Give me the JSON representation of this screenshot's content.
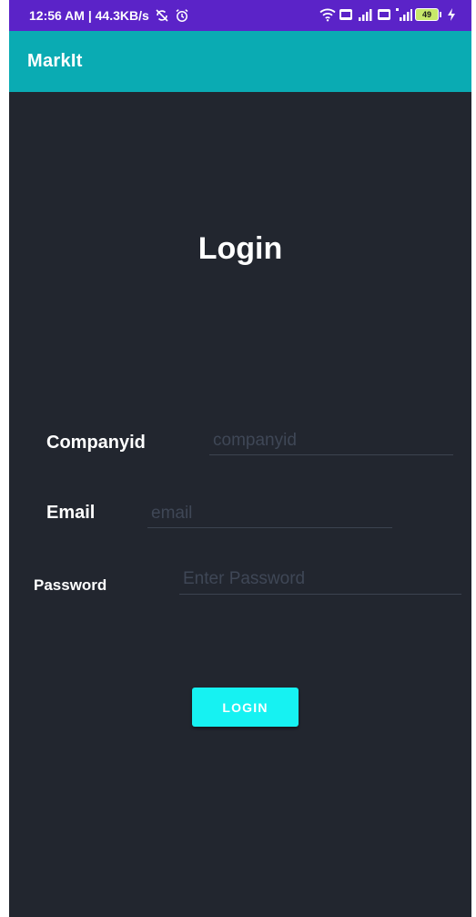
{
  "status_bar": {
    "time_speed": "12:56 AM | 44.3KB/s",
    "battery": "49",
    "colors": {
      "background": "#5b23c8"
    },
    "icons": [
      "no-sync-icon",
      "alarm-icon",
      "wifi-icon",
      "volte-icon",
      "signal-icon",
      "volte-icon-2",
      "4g-signal-icon",
      "battery-icon",
      "charging-icon"
    ]
  },
  "app_bar": {
    "title": "MarkIt",
    "color": "#0aabb3"
  },
  "login": {
    "heading": "Login",
    "fields": {
      "companyid": {
        "label": "Companyid",
        "placeholder": "companyid",
        "value": ""
      },
      "email": {
        "label": "Email",
        "placeholder": "email",
        "value": ""
      },
      "password": {
        "label": "Password",
        "placeholder": "Enter Password",
        "value": ""
      }
    },
    "button_label": "LOGIN",
    "button_color": "#16f2f2",
    "background_color": "#22262f"
  }
}
